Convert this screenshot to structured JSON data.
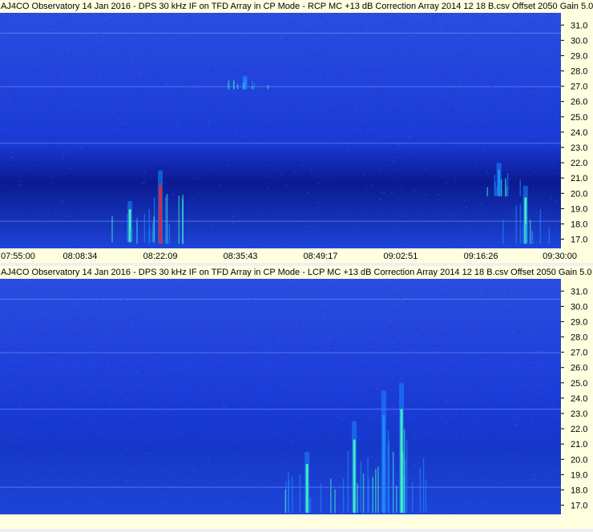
{
  "charts": [
    {
      "id": "rcp",
      "title": "AJ4CO Observatory 14 Jan 2016 - DPS 30 kHz IF on TFD Array in CP Mode - RCP  MC +13 dB  Correction Array 2014 12 18 B.csv  Offset 2050  Gain 5.0",
      "show_time_axis": true
    },
    {
      "id": "lcp",
      "title": "AJ4CO Observatory 14 Jan 2016 - DPS 30 kHz IF on TFD Array in CP Mode - LCP  MC +13 dB  Correction Array 2014 12 18 B.csv  Offset 2050  Gain 5.0",
      "show_time_axis": false
    }
  ],
  "chart_data": [
    {
      "type": "heatmap",
      "polarization": "RCP",
      "title": "AJ4CO Observatory 14 Jan 2016 - DPS 30 kHz IF on TFD Array in CP Mode - RCP  MC +13 dB  Correction Array 2014 12 18 B.csv  Offset 2050  Gain 5.0",
      "x_ticks": [
        "07:55:00",
        "08:08:34",
        "08:22:09",
        "08:35:43",
        "08:49:17",
        "09:02:51",
        "09:16:26",
        "09:30:00"
      ],
      "y_ticks": [
        "31.0",
        "30.0",
        "29.0",
        "28.0",
        "27.0",
        "26.0",
        "25.0",
        "24.0",
        "23.0",
        "22.0",
        "21.0",
        "20.0",
        "19.0",
        "18.0",
        "17.0"
      ],
      "colors": {
        "background": "#1a3ad6",
        "low": "#0a1a90",
        "mid": "#1e88ff",
        "high": "#40f0c0",
        "peak": "#ff2020"
      },
      "features": [
        {
          "time": "08:22:09",
          "freq_low": 16.7,
          "freq_high": 21.5,
          "intensity": "peak"
        },
        {
          "time": "08:17:00",
          "freq_low": 16.8,
          "freq_high": 19.5,
          "intensity": "high"
        },
        {
          "time": "08:36:30",
          "freq_low": 26.8,
          "freq_high": 27.7,
          "intensity": "mid"
        },
        {
          "time": "09:19:30",
          "freq_low": 19.8,
          "freq_high": 22.0,
          "intensity": "mid"
        },
        {
          "time": "09:24:00",
          "freq_low": 16.7,
          "freq_high": 20.5,
          "intensity": "high"
        }
      ]
    },
    {
      "type": "heatmap",
      "polarization": "LCP",
      "title": "AJ4CO Observatory 14 Jan 2016 - DPS 30 kHz IF on TFD Array in CP Mode - LCP  MC +13 dB  Correction Array 2014 12 18 B.csv  Offset 2050  Gain 5.0",
      "y_ticks": [
        "31.0",
        "30.0",
        "29.0",
        "28.0",
        "27.0",
        "26.0",
        "25.0",
        "24.0",
        "23.0",
        "22.0",
        "21.0",
        "20.0",
        "19.0",
        "18.0",
        "17.0"
      ],
      "colors": {
        "background": "#1a3ad6",
        "low": "#0a1a90",
        "mid": "#1e88ff",
        "high": "#40f0c0",
        "peak": "#c0ff40"
      },
      "features": [
        {
          "time": "08:47:00",
          "freq_low": 16.5,
          "freq_high": 20.5,
          "intensity": "high"
        },
        {
          "time": "08:55:00",
          "freq_low": 16.5,
          "freq_high": 22.5,
          "intensity": "high"
        },
        {
          "time": "09:00:00",
          "freq_low": 16.5,
          "freq_high": 24.5,
          "intensity": "mid"
        },
        {
          "time": "09:03:00",
          "freq_low": 16.5,
          "freq_high": 25.0,
          "intensity": "high"
        }
      ]
    }
  ]
}
